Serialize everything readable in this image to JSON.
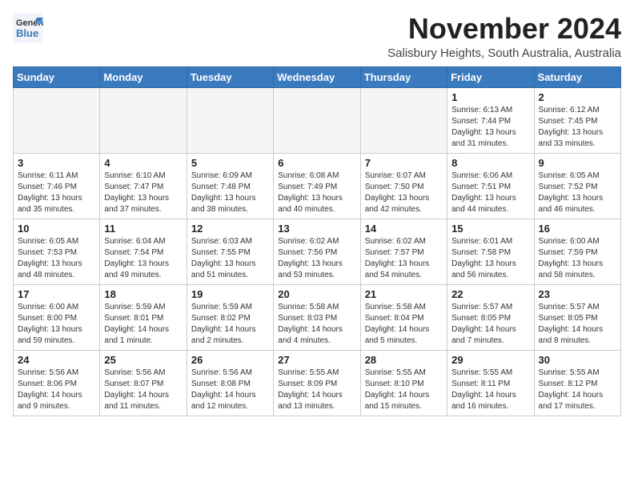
{
  "header": {
    "logo_general": "General",
    "logo_blue": "Blue",
    "month_title": "November 2024",
    "location": "Salisbury Heights, South Australia, Australia"
  },
  "days_of_week": [
    "Sunday",
    "Monday",
    "Tuesday",
    "Wednesday",
    "Thursday",
    "Friday",
    "Saturday"
  ],
  "weeks": [
    [
      {
        "day": "",
        "info": ""
      },
      {
        "day": "",
        "info": ""
      },
      {
        "day": "",
        "info": ""
      },
      {
        "day": "",
        "info": ""
      },
      {
        "day": "",
        "info": ""
      },
      {
        "day": "1",
        "info": "Sunrise: 6:13 AM\nSunset: 7:44 PM\nDaylight: 13 hours and 31 minutes."
      },
      {
        "day": "2",
        "info": "Sunrise: 6:12 AM\nSunset: 7:45 PM\nDaylight: 13 hours and 33 minutes."
      }
    ],
    [
      {
        "day": "3",
        "info": "Sunrise: 6:11 AM\nSunset: 7:46 PM\nDaylight: 13 hours and 35 minutes."
      },
      {
        "day": "4",
        "info": "Sunrise: 6:10 AM\nSunset: 7:47 PM\nDaylight: 13 hours and 37 minutes."
      },
      {
        "day": "5",
        "info": "Sunrise: 6:09 AM\nSunset: 7:48 PM\nDaylight: 13 hours and 38 minutes."
      },
      {
        "day": "6",
        "info": "Sunrise: 6:08 AM\nSunset: 7:49 PM\nDaylight: 13 hours and 40 minutes."
      },
      {
        "day": "7",
        "info": "Sunrise: 6:07 AM\nSunset: 7:50 PM\nDaylight: 13 hours and 42 minutes."
      },
      {
        "day": "8",
        "info": "Sunrise: 6:06 AM\nSunset: 7:51 PM\nDaylight: 13 hours and 44 minutes."
      },
      {
        "day": "9",
        "info": "Sunrise: 6:05 AM\nSunset: 7:52 PM\nDaylight: 13 hours and 46 minutes."
      }
    ],
    [
      {
        "day": "10",
        "info": "Sunrise: 6:05 AM\nSunset: 7:53 PM\nDaylight: 13 hours and 48 minutes."
      },
      {
        "day": "11",
        "info": "Sunrise: 6:04 AM\nSunset: 7:54 PM\nDaylight: 13 hours and 49 minutes."
      },
      {
        "day": "12",
        "info": "Sunrise: 6:03 AM\nSunset: 7:55 PM\nDaylight: 13 hours and 51 minutes."
      },
      {
        "day": "13",
        "info": "Sunrise: 6:02 AM\nSunset: 7:56 PM\nDaylight: 13 hours and 53 minutes."
      },
      {
        "day": "14",
        "info": "Sunrise: 6:02 AM\nSunset: 7:57 PM\nDaylight: 13 hours and 54 minutes."
      },
      {
        "day": "15",
        "info": "Sunrise: 6:01 AM\nSunset: 7:58 PM\nDaylight: 13 hours and 56 minutes."
      },
      {
        "day": "16",
        "info": "Sunrise: 6:00 AM\nSunset: 7:59 PM\nDaylight: 13 hours and 58 minutes."
      }
    ],
    [
      {
        "day": "17",
        "info": "Sunrise: 6:00 AM\nSunset: 8:00 PM\nDaylight: 13 hours and 59 minutes."
      },
      {
        "day": "18",
        "info": "Sunrise: 5:59 AM\nSunset: 8:01 PM\nDaylight: 14 hours and 1 minute."
      },
      {
        "day": "19",
        "info": "Sunrise: 5:59 AM\nSunset: 8:02 PM\nDaylight: 14 hours and 2 minutes."
      },
      {
        "day": "20",
        "info": "Sunrise: 5:58 AM\nSunset: 8:03 PM\nDaylight: 14 hours and 4 minutes."
      },
      {
        "day": "21",
        "info": "Sunrise: 5:58 AM\nSunset: 8:04 PM\nDaylight: 14 hours and 5 minutes."
      },
      {
        "day": "22",
        "info": "Sunrise: 5:57 AM\nSunset: 8:05 PM\nDaylight: 14 hours and 7 minutes."
      },
      {
        "day": "23",
        "info": "Sunrise: 5:57 AM\nSunset: 8:05 PM\nDaylight: 14 hours and 8 minutes."
      }
    ],
    [
      {
        "day": "24",
        "info": "Sunrise: 5:56 AM\nSunset: 8:06 PM\nDaylight: 14 hours and 9 minutes."
      },
      {
        "day": "25",
        "info": "Sunrise: 5:56 AM\nSunset: 8:07 PM\nDaylight: 14 hours and 11 minutes."
      },
      {
        "day": "26",
        "info": "Sunrise: 5:56 AM\nSunset: 8:08 PM\nDaylight: 14 hours and 12 minutes."
      },
      {
        "day": "27",
        "info": "Sunrise: 5:55 AM\nSunset: 8:09 PM\nDaylight: 14 hours and 13 minutes."
      },
      {
        "day": "28",
        "info": "Sunrise: 5:55 AM\nSunset: 8:10 PM\nDaylight: 14 hours and 15 minutes."
      },
      {
        "day": "29",
        "info": "Sunrise: 5:55 AM\nSunset: 8:11 PM\nDaylight: 14 hours and 16 minutes."
      },
      {
        "day": "30",
        "info": "Sunrise: 5:55 AM\nSunset: 8:12 PM\nDaylight: 14 hours and 17 minutes."
      }
    ]
  ]
}
